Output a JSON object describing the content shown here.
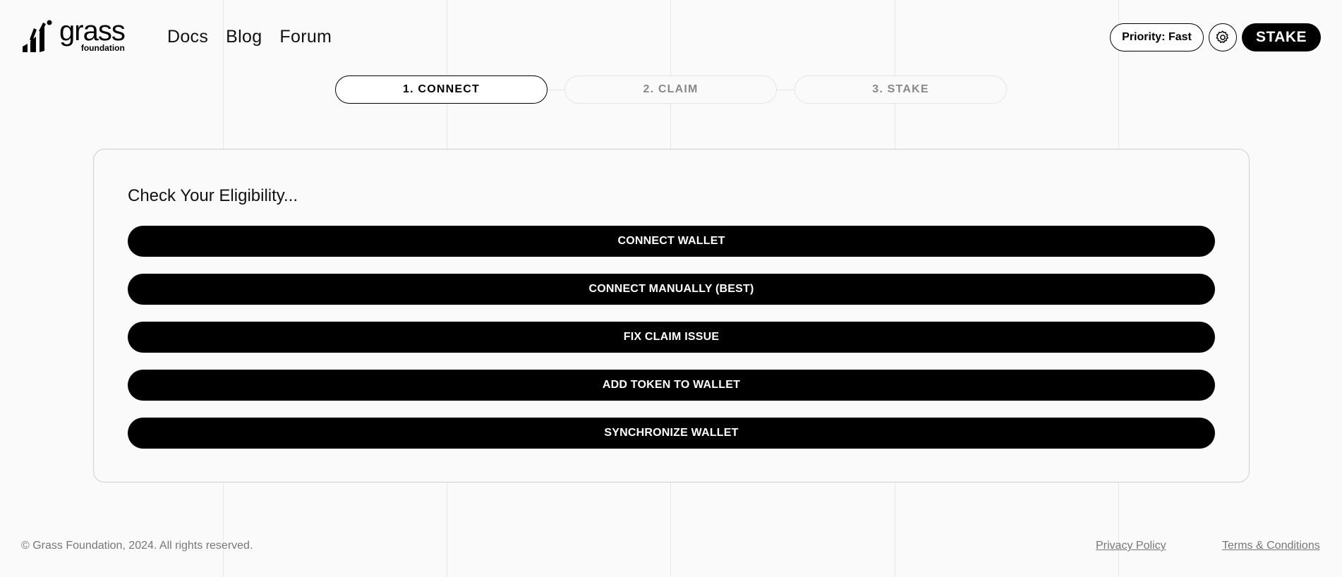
{
  "brand": {
    "name": "grass",
    "sub": "foundation",
    "logo_icon": "grass-bars-logo"
  },
  "nav": {
    "items": [
      {
        "label": "Docs"
      },
      {
        "label": "Blog"
      },
      {
        "label": "Forum"
      }
    ]
  },
  "header": {
    "priority_label": "Priority: Fast",
    "settings_icon": "gear-icon",
    "stake_label": "STAKE"
  },
  "stepper": {
    "steps": [
      {
        "label": "1. CONNECT",
        "state": "active"
      },
      {
        "label": "2. CLAIM",
        "state": "inactive"
      },
      {
        "label": "3. STAKE",
        "state": "inactive"
      }
    ]
  },
  "card": {
    "title": "Check Your Eligibility...",
    "buttons": [
      {
        "label": "CONNECT WALLET"
      },
      {
        "label": "CONNECT MANUALLY (BEST)"
      },
      {
        "label": "FIX CLAIM ISSUE"
      },
      {
        "label": "ADD TOKEN TO WALLET"
      },
      {
        "label": "SYNCHRONIZE WALLET"
      }
    ]
  },
  "footer": {
    "copyright": "© Grass Foundation, 2024. All rights reserved.",
    "privacy_label": "Privacy Policy",
    "terms_label": "Terms & Conditions"
  },
  "colors": {
    "background": "#fafafa",
    "primary": "#000000",
    "muted_text": "#777777",
    "grid_line": "#e6e6e6"
  }
}
